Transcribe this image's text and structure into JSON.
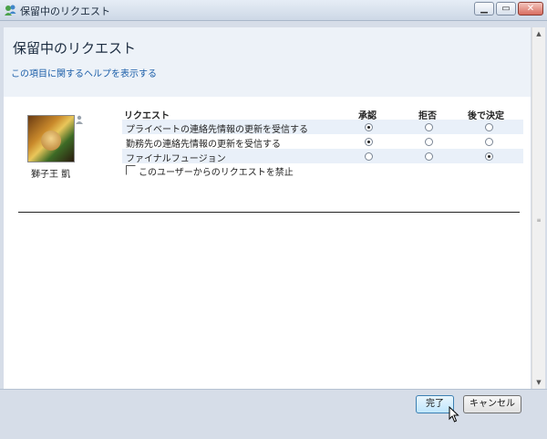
{
  "window": {
    "title": "保留中のリクエスト"
  },
  "page": {
    "title": "保留中のリクエスト",
    "help_link": "この項目に関するヘルプを表示する"
  },
  "contact": {
    "name": "獅子王 凱"
  },
  "columns": {
    "request": "リクエスト",
    "approve": "承認",
    "reject": "拒否",
    "later": "後で決定"
  },
  "requests": [
    {
      "label": "プライベートの連絡先情報の更新を受信する",
      "selected": "approve"
    },
    {
      "label": "勤務先の連絡先情報の更新を受信する",
      "selected": "approve"
    },
    {
      "label": "ファイナルフュージョン",
      "selected": "later"
    }
  ],
  "block_user": {
    "label": "このユーザーからのリクエストを禁止",
    "checked": false
  },
  "buttons": {
    "done": "完了",
    "cancel": "キャンセル"
  },
  "colors": {
    "link": "#1a5da8",
    "header_bg": "#edf2f8",
    "row_shade": "#e9f0f9"
  }
}
